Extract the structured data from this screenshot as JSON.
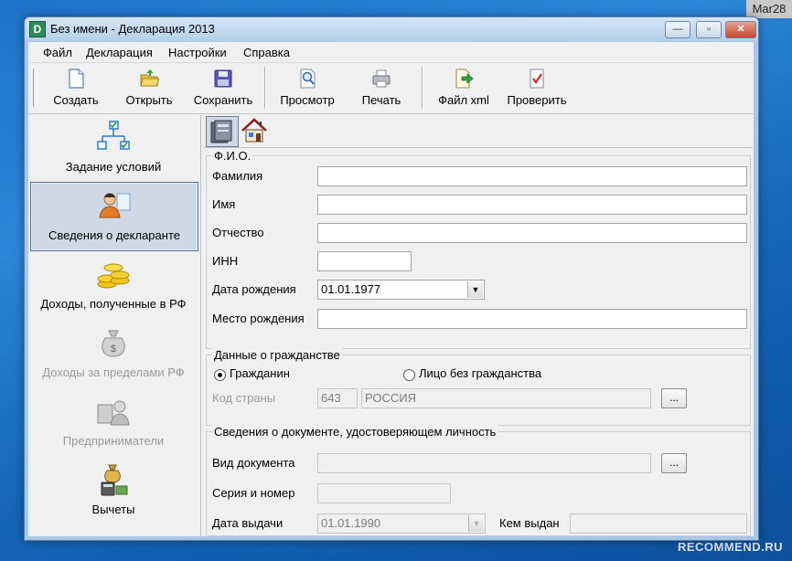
{
  "overlay": {
    "corner_tag": "Mar28",
    "watermark": "RECOMMEND.RU"
  },
  "window": {
    "title": "Без имени - Декларация 2013",
    "controls": {
      "minimize": "—",
      "maximize": "▫",
      "close": "✕"
    }
  },
  "menu": {
    "items": [
      "Файл",
      "Декларация",
      "Настройки",
      "Справка"
    ]
  },
  "toolbar": {
    "buttons": [
      "Создать",
      "Открыть",
      "Сохранить",
      "Просмотр",
      "Печать",
      "Файл xml",
      "Проверить"
    ]
  },
  "sidebar": {
    "items": [
      {
        "label": "Задание условий",
        "icon": "flowchart-icon",
        "state": "normal"
      },
      {
        "label": "Сведения о декларанте",
        "icon": "person-icon",
        "state": "active"
      },
      {
        "label": "Доходы, полученные в РФ",
        "icon": "coins-icon",
        "state": "normal"
      },
      {
        "label": "Доходы за пределами РФ",
        "icon": "money-bag-icon",
        "state": "disabled"
      },
      {
        "label": "Предприниматели",
        "icon": "entrepreneur-icon",
        "state": "disabled"
      },
      {
        "label": "Вычеты",
        "icon": "deductions-icon",
        "state": "normal"
      }
    ]
  },
  "tabs": [
    {
      "icon": "id-card-icon",
      "active": true
    },
    {
      "icon": "house-icon",
      "active": false
    }
  ],
  "fio_group": {
    "legend": "Ф.И.О.",
    "surname_label": "Фамилия",
    "surname_value": "",
    "name_label": "Имя",
    "name_value": "",
    "patronymic_label": "Отчество",
    "patronymic_value": "",
    "inn_label": "ИНН",
    "inn_value": "",
    "birthdate_label": "Дата рождения",
    "birthdate_value": "01.01.1977",
    "birthplace_label": "Место рождения",
    "birthplace_value": ""
  },
  "citizenship_group": {
    "legend": "Данные о гражданстве",
    "citizen_label": "Гражданин",
    "stateless_label": "Лицо без гражданства",
    "selected": "citizen",
    "country_code_label": "Код страны",
    "country_code_value": "643",
    "country_name_value": "РОССИЯ",
    "browse_label": "..."
  },
  "document_group": {
    "legend": "Сведения о документе, удостоверяющем личность",
    "doc_type_label": "Вид документа",
    "doc_type_value": "",
    "browse_label": "...",
    "series_label": "Серия и номер",
    "series_value": "",
    "issue_date_label": "Дата выдачи",
    "issue_date_value": "01.01.1990",
    "issued_by_label": "Кем выдан",
    "issued_by_value": ""
  },
  "colors": {
    "desktop": "#1e73c8",
    "window_frame": "#a9c7e6",
    "panel": "#f0f0f0",
    "active_item": "#cfd9e6"
  }
}
